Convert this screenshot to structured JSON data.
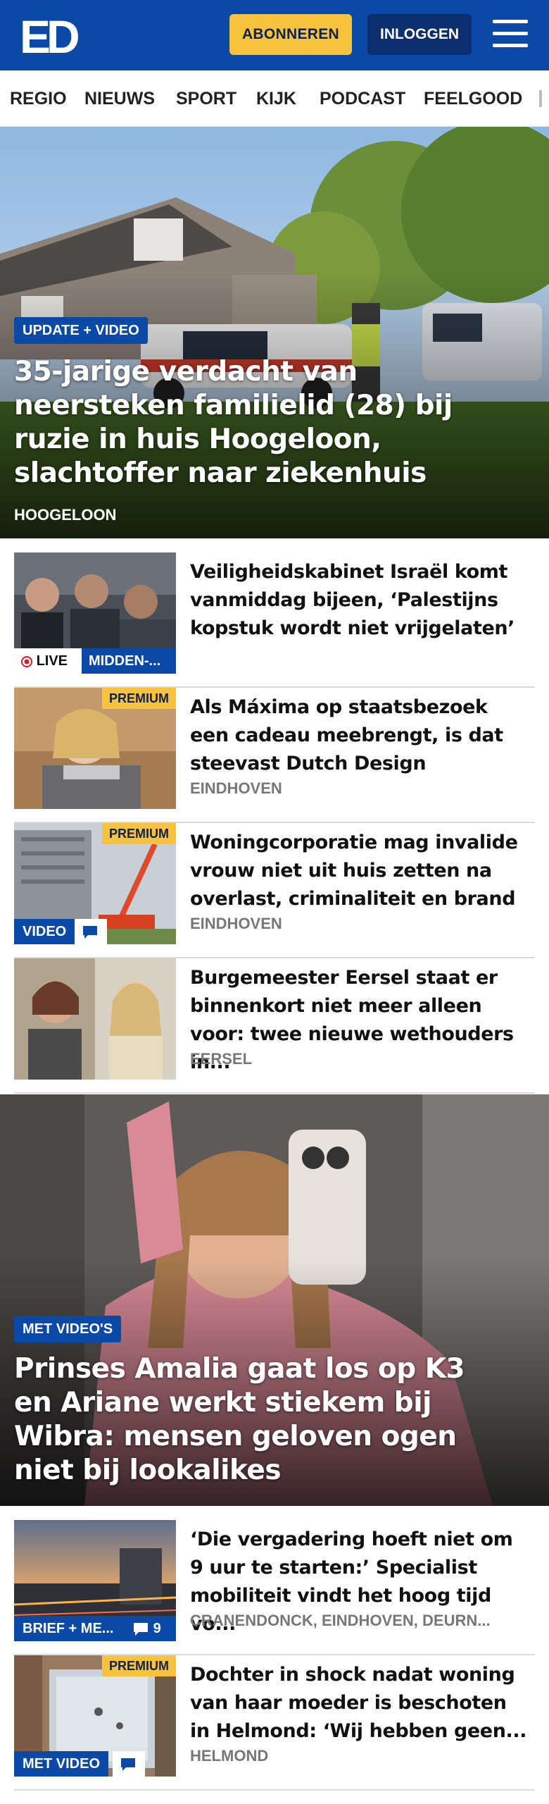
{
  "header": {
    "logo": "ED",
    "subscribe_label": "ABONNEREN",
    "login_label": "INLOGGEN",
    "colors": {
      "brand": "#0a4aa6",
      "accent": "#f7c23c"
    }
  },
  "nav": {
    "items": [
      "REGIO",
      "NIEUWS",
      "SPORT",
      "KIJK",
      "PODCAST",
      "FEELGOOD"
    ]
  },
  "hero": {
    "badge": "UPDATE + VIDEO",
    "title": "35-jarige verdacht van neersteken familielid (28) bij ruzie in huis Hoogeloon, slachtoffer naar ziekenhuis",
    "location": "HOOGELOON"
  },
  "articles": [
    {
      "title": "Veiligheidskabinet Israël komt vanmiddag bijeen, ‘Palestijns kopstuk wordt niet vrijgelaten’",
      "live_label": "LIVE",
      "tag": "MIDDEN-..."
    },
    {
      "title": "Als Máxima op staatsbezoek een cadeau meebrengt, is dat steevast Dutch Design",
      "location": "EINDHOVEN",
      "premium": "PREMIUM"
    },
    {
      "title": "Woningcorporatie mag invalide vrouw niet uit huis zetten na overlast, criminaliteit en brand",
      "location": "EINDHOVEN",
      "premium": "PREMIUM",
      "tag": "VIDEO"
    },
    {
      "title": "Burgemeester Eersel staat er binnenkort niet meer alleen voor: twee nieuwe wethouders in...",
      "location": "EERSEL"
    }
  ],
  "hero2": {
    "badge": "MET VIDEO'S",
    "title": "Prinses Amalia gaat los op K3 en Ariane werkt stiekem bij Wibra: mensen geloven ogen niet bij lookalikes"
  },
  "articles2": [
    {
      "title": "‘Die vergadering hoeft niet om 9 uur te starten:’ Specialist mobiliteit vindt het hoog tijd vo...",
      "location": "CRANENDONCK, EINDHOVEN, DEURN...",
      "tag": "BRIEF + ME...",
      "comments": "9"
    },
    {
      "title": "Dochter in shock nadat woning van haar moeder is beschoten in Helmond: ‘Wij hebben geen...",
      "location": "HELMOND",
      "premium": "PREMIUM",
      "tag": "MET VIDEO"
    }
  ]
}
